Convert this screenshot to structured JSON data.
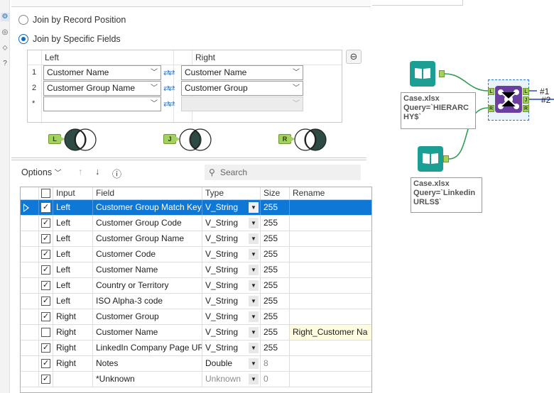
{
  "join_options": {
    "by_position_label": "Join by Record Position",
    "by_fields_label": "Join by Specific Fields",
    "selected": "by_fields"
  },
  "join_grid": {
    "left_header": "Left",
    "right_header": "Right",
    "rows": [
      {
        "num": "1",
        "left": "Customer Name",
        "right": "Customer Name"
      },
      {
        "num": "2",
        "left": "Customer Group Name",
        "right": "Customer Group"
      },
      {
        "num": "*",
        "left": "",
        "right": ""
      }
    ]
  },
  "venn": {
    "left_tag": "L",
    "join_tag": "J",
    "right_tag": "R"
  },
  "toolbar": {
    "options_label": "Options",
    "search_placeholder": "Search"
  },
  "table": {
    "headers": {
      "input": "Input",
      "field": "Field",
      "type": "Type",
      "size": "Size",
      "rename": "Rename"
    },
    "rows": [
      {
        "checked": true,
        "input": "Left",
        "field": "Customer Group Match Key",
        "type": "V_String",
        "size": "255",
        "rename": "",
        "selected": true
      },
      {
        "checked": true,
        "input": "Left",
        "field": "Customer Group Code",
        "type": "V_String",
        "size": "255",
        "rename": ""
      },
      {
        "checked": true,
        "input": "Left",
        "field": "Customer Group Name",
        "type": "V_String",
        "size": "255",
        "rename": ""
      },
      {
        "checked": true,
        "input": "Left",
        "field": "Customer Code",
        "type": "V_String",
        "size": "255",
        "rename": ""
      },
      {
        "checked": true,
        "input": "Left",
        "field": "Customer Name",
        "type": "V_String",
        "size": "255",
        "rename": ""
      },
      {
        "checked": true,
        "input": "Left",
        "field": "Country or Territory",
        "type": "V_String",
        "size": "255",
        "rename": ""
      },
      {
        "checked": true,
        "input": "Left",
        "field": "ISO Alpha-3 code",
        "type": "V_String",
        "size": "255",
        "rename": ""
      },
      {
        "checked": true,
        "input": "Right",
        "field": "Customer Group",
        "type": "V_String",
        "size": "255",
        "rename": ""
      },
      {
        "checked": false,
        "input": "Right",
        "field": "Customer Name",
        "type": "V_String",
        "size": "255",
        "rename": "Right_Customer Na"
      },
      {
        "checked": true,
        "input": "Right",
        "field": "LinkedIn Company Page URL",
        "type": "V_String",
        "size": "255",
        "rename": ""
      },
      {
        "checked": true,
        "input": "Right",
        "field": "Notes",
        "type": "Double",
        "size": "8",
        "rename": ""
      },
      {
        "checked": true,
        "input": "",
        "field": "*Unknown",
        "type": "Unknown",
        "size": "0",
        "rename": ""
      }
    ]
  },
  "canvas": {
    "input1_annotation": "Case.xlsx\nQuery=`HIERARC\nHY$`",
    "input2_annotation": "Case.xlsx\nQuery=`Linkedin\nURLS$`",
    "join_anchor_left": "L",
    "join_anchor_right": "R",
    "join_out_l": "L",
    "join_out_j": "J",
    "join_out_r": "R",
    "out_label_1": "#2",
    "out_label_2": "#1"
  },
  "colors": {
    "selection": "#0f78d7",
    "anchor_green": "#a3d15e",
    "input_tool_teal": "#1b9e93",
    "join_tool_purple": "#6b3fa0",
    "connection_green": "#2e9d4e"
  }
}
